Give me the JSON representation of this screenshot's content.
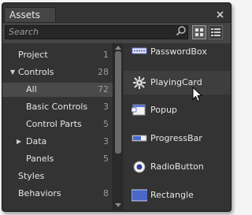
{
  "window": {
    "tab_title": "Assets"
  },
  "search": {
    "placeholder": "Search"
  },
  "tree": [
    {
      "label": "Project",
      "count": "1",
      "indent": 0,
      "expander": ""
    },
    {
      "label": "Controls",
      "count": "28",
      "indent": 0,
      "expander": "▼"
    },
    {
      "label": "All",
      "count": "72",
      "indent": 1,
      "expander": "",
      "selected": true
    },
    {
      "label": "Basic Controls",
      "count": "3",
      "indent": 1,
      "expander": ""
    },
    {
      "label": "Control Parts",
      "count": "5",
      "indent": 1,
      "expander": ""
    },
    {
      "label": "Data",
      "count": "3",
      "indent": 1,
      "expander": "▶"
    },
    {
      "label": "Panels",
      "count": "5",
      "indent": 1,
      "expander": ""
    },
    {
      "label": "Styles",
      "count": "",
      "indent": 0,
      "expander": ""
    },
    {
      "label": "Behaviors",
      "count": "8",
      "indent": 0,
      "expander": ""
    }
  ],
  "assets": [
    {
      "name": "PasswordBox",
      "icon": "passwordbox-icon"
    },
    {
      "name": "PlayingCard",
      "icon": "playingcard-icon"
    },
    {
      "name": "Popup",
      "icon": "popup-icon"
    },
    {
      "name": "ProgressBar",
      "icon": "progressbar-icon"
    },
    {
      "name": "RadioButton",
      "icon": "radiobutton-icon"
    },
    {
      "name": "Rectangle",
      "icon": "rectangle-icon"
    }
  ]
}
